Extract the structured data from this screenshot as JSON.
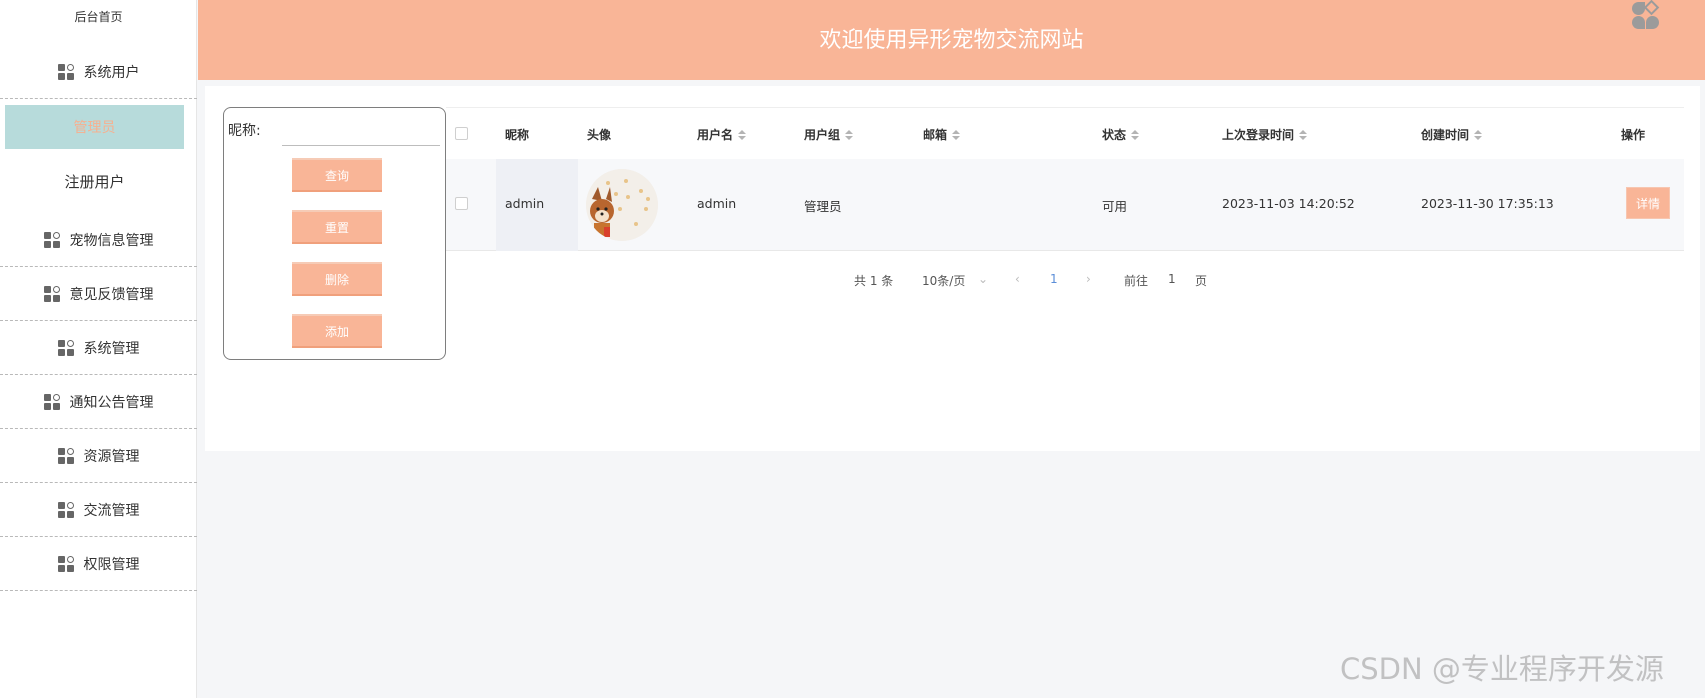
{
  "sidebar": {
    "home_label": "后台首页",
    "items": [
      {
        "label": "系统用户",
        "icon": "grid-icon"
      },
      {
        "label": "宠物信息管理",
        "icon": "grid-icon"
      },
      {
        "label": "意见反馈管理",
        "icon": "grid-icon"
      },
      {
        "label": "系统管理",
        "icon": "grid-icon"
      },
      {
        "label": "通知公告管理",
        "icon": "grid-icon"
      },
      {
        "label": "资源管理",
        "icon": "grid-icon"
      },
      {
        "label": "交流管理",
        "icon": "grid-icon"
      },
      {
        "label": "权限管理",
        "icon": "grid-icon"
      }
    ],
    "sub_items": [
      {
        "label": "管理员",
        "active": true
      },
      {
        "label": "注册用户",
        "active": false
      }
    ]
  },
  "header": {
    "title": "欢迎使用异形宠物交流网站",
    "logo_icon": "logo-icon"
  },
  "search": {
    "label": "昵称:",
    "input_value": "",
    "buttons": {
      "query": "查询",
      "reset": "重置",
      "delete": "删除",
      "add": "添加"
    }
  },
  "table": {
    "columns": [
      "昵称",
      "头像",
      "用户名",
      "用户组",
      "邮箱",
      "状态",
      "上次登录时间",
      "创建时间",
      "操作"
    ],
    "rows": [
      {
        "nickname": "admin",
        "avatar": "dog-avatar",
        "username": "admin",
        "group": "管理员",
        "email": "",
        "status": "可用",
        "last_login": "2023-11-03 14:20:52",
        "created": "2023-11-30 17:35:13",
        "action": "详情"
      }
    ]
  },
  "pagination": {
    "total": "共 1 条",
    "page_size": "10条/页",
    "current_page": "1",
    "goto_label": "前往",
    "goto_value": "1",
    "page_suffix": "页"
  },
  "watermark": "CSDN @专业程序开发源",
  "colors": {
    "accent": "#f9b597",
    "active_sub_bg": "#b7dbdb",
    "active_page": "#5b8ed8"
  }
}
